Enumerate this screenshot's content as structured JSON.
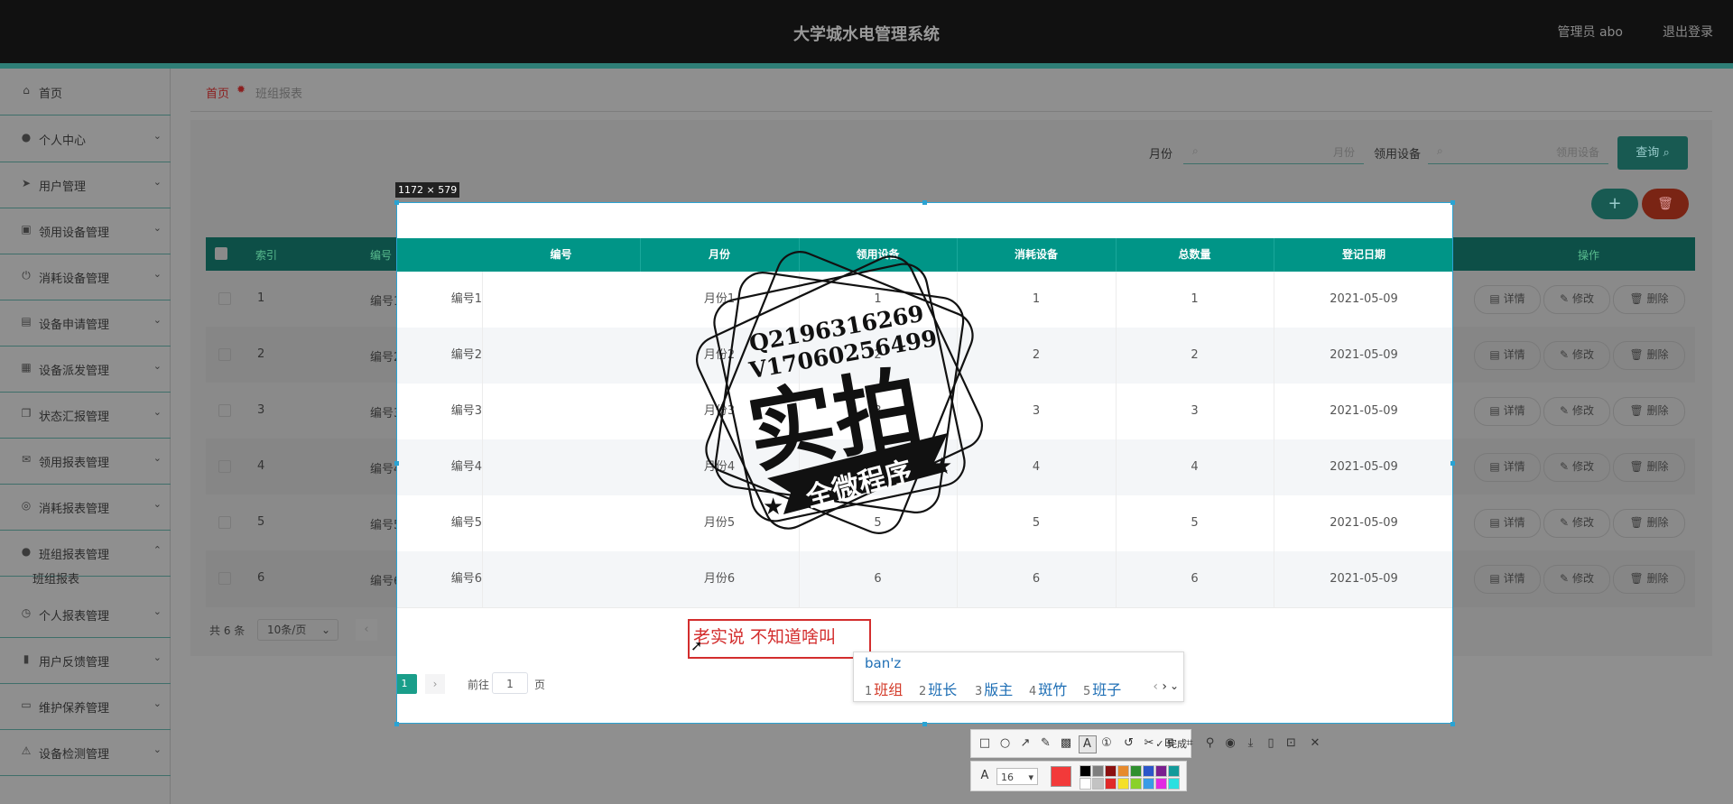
{
  "header": {
    "title": "大学城水电管理系统",
    "admin": "管理员 abo",
    "logout": "退出登录"
  },
  "sidebar": {
    "items": [
      {
        "label": "首页",
        "icon": "home-icon",
        "glyph": "⌂",
        "chevron": ""
      },
      {
        "label": "个人中心",
        "icon": "user-icon",
        "glyph": "●",
        "chevron": "⌄"
      },
      {
        "label": "用户管理",
        "icon": "send-icon",
        "glyph": "➤",
        "chevron": "⌄"
      },
      {
        "label": "领用设备管理",
        "icon": "form-icon",
        "glyph": "▣",
        "chevron": "⌄"
      },
      {
        "label": "消耗设备管理",
        "icon": "power-icon",
        "glyph": "⏻",
        "chevron": "⌄"
      },
      {
        "label": "设备申请管理",
        "icon": "stamp-icon",
        "glyph": "▤",
        "chevron": "⌄"
      },
      {
        "label": "设备派发管理",
        "icon": "box-icon",
        "glyph": "▦",
        "chevron": "⌄"
      },
      {
        "label": "状态汇报管理",
        "icon": "copy-icon",
        "glyph": "❐",
        "chevron": "⌄"
      },
      {
        "label": "领用报表管理",
        "icon": "message-icon",
        "glyph": "✉",
        "chevron": "⌄"
      },
      {
        "label": "消耗报表管理",
        "icon": "compass-icon",
        "glyph": "◎",
        "chevron": "⌄"
      },
      {
        "label": "班组报表管理",
        "icon": "user-icon",
        "glyph": "●",
        "chevron": "⌃"
      },
      {
        "label": "个人报表管理",
        "icon": "time-icon",
        "glyph": "◷",
        "chevron": "⌄"
      },
      {
        "label": "用户反馈管理",
        "icon": "goods-icon",
        "glyph": "▮",
        "chevron": "⌄"
      },
      {
        "label": "维护保养管理",
        "icon": "chat-icon",
        "glyph": "▭",
        "chevron": "⌄"
      },
      {
        "label": "设备检测管理",
        "icon": "warning-icon",
        "glyph": "⚠",
        "chevron": "⌄"
      }
    ],
    "sub_item": "班组报表"
  },
  "breadcrumb": {
    "home": "首页",
    "current": "班组报表"
  },
  "search": {
    "month_label": "月份",
    "month_placeholder": "月份",
    "device_label": "领用设备",
    "device_placeholder": "领用设备",
    "query_button": "查询"
  },
  "table": {
    "headers": [
      "索引",
      "编号",
      "月份",
      "领用设备",
      "消耗设备",
      "总数量",
      "登记日期",
      "操作"
    ],
    "rows": [
      {
        "index": "1",
        "code": "编号1",
        "month": "月份1",
        "lingyong": "1",
        "xiaohao": "1",
        "total": "1",
        "date": "2021-05-09"
      },
      {
        "index": "2",
        "code": "编号2",
        "month": "月份2",
        "lingyong": "2",
        "xiaohao": "2",
        "total": "2",
        "date": "2021-05-09"
      },
      {
        "index": "3",
        "code": "编号3",
        "month": "月份3",
        "lingyong": "3",
        "xiaohao": "3",
        "total": "3",
        "date": "2021-05-09"
      },
      {
        "index": "4",
        "code": "编号4",
        "month": "月份4",
        "lingyong": "4",
        "xiaohao": "4",
        "total": "4",
        "date": "2021-05-09"
      },
      {
        "index": "5",
        "code": "编号5",
        "month": "月份5",
        "lingyong": "5",
        "xiaohao": "5",
        "total": "5",
        "date": "2021-05-09"
      },
      {
        "index": "6",
        "code": "编号6",
        "month": "月份6",
        "lingyong": "6",
        "xiaohao": "6",
        "total": "6",
        "date": "2021-05-09"
      }
    ],
    "actions": {
      "detail": "详情",
      "edit": "修改",
      "delete": "删除"
    }
  },
  "pager": {
    "total": "共 6 条",
    "page_size": "10条/页",
    "current_page": "1",
    "goto_prefix": "前往",
    "goto_value": "1",
    "goto_suffix": "页"
  },
  "capture": {
    "size_label": "1172 × 579",
    "annotation_text": "老实说 不知道啥叫"
  },
  "watermark": {
    "line1": "Q2196316269",
    "line2": "V17060256499",
    "main": "实拍",
    "banner": "全微程序"
  },
  "ime": {
    "composition": "ban'z",
    "candidates": [
      {
        "n": "1",
        "text": "班组"
      },
      {
        "n": "2",
        "text": "班长"
      },
      {
        "n": "3",
        "text": "版主"
      },
      {
        "n": "4",
        "text": "斑竹"
      },
      {
        "n": "5",
        "text": "班子"
      }
    ]
  },
  "toolbar": {
    "done": "完成",
    "font_size": "16",
    "selected_color": "#f23a3a"
  },
  "colors": {
    "accent": "#009587",
    "danger": "#d32d2d",
    "brand_dark": "#0d4f47"
  }
}
